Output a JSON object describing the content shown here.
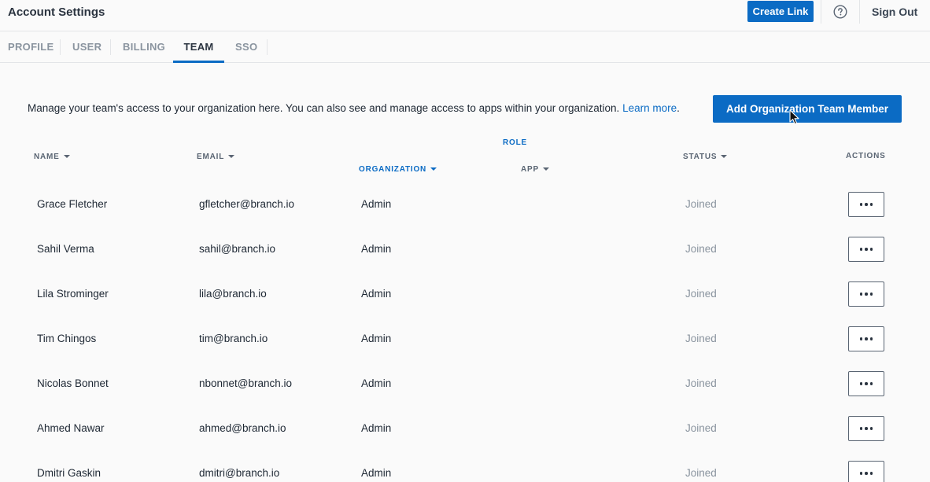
{
  "header": {
    "title": "Account Settings",
    "create_link_label": "Create Link",
    "help_icon": "question-circle-icon",
    "sign_out_label": "Sign Out"
  },
  "tabs": [
    {
      "label": "PROFILE",
      "active": false
    },
    {
      "label": "USER",
      "active": false
    },
    {
      "label": "BILLING",
      "active": false
    },
    {
      "label": "TEAM",
      "active": true
    },
    {
      "label": "SSO",
      "active": false
    }
  ],
  "intro": {
    "text": "Manage your team's access to your organization here. You can also see and manage access to apps within your organization.",
    "link_label": "Learn more",
    "trailing": "."
  },
  "add_member_label": "Add Organization Team Member",
  "table": {
    "headers": {
      "name": "NAME",
      "email": "EMAIL",
      "role_group": "ROLE",
      "organization": "ORGANIZATION",
      "app": "APP",
      "status": "STATUS",
      "actions": "ACTIONS"
    },
    "rows": [
      {
        "name": "Grace Fletcher",
        "email": "gfletcher@branch.io",
        "organization": "Admin",
        "app": "",
        "status": "Joined"
      },
      {
        "name": "Sahil Verma",
        "email": "sahil@branch.io",
        "organization": "Admin",
        "app": "",
        "status": "Joined"
      },
      {
        "name": "Lila Strominger",
        "email": "lila@branch.io",
        "organization": "Admin",
        "app": "",
        "status": "Joined"
      },
      {
        "name": "Tim Chingos",
        "email": "tim@branch.io",
        "organization": "Admin",
        "app": "",
        "status": "Joined"
      },
      {
        "name": "Nicolas Bonnet",
        "email": "nbonnet@branch.io",
        "organization": "Admin",
        "app": "",
        "status": "Joined"
      },
      {
        "name": "Ahmed Nawar",
        "email": "ahmed@branch.io",
        "organization": "Admin",
        "app": "",
        "status": "Joined"
      },
      {
        "name": "Dmitri Gaskin",
        "email": "dmitri@branch.io",
        "organization": "Admin",
        "app": "",
        "status": "Joined"
      }
    ]
  },
  "colors": {
    "accent": "#0b6bc4",
    "muted_text": "#8a949f",
    "background": "#fafafa"
  }
}
